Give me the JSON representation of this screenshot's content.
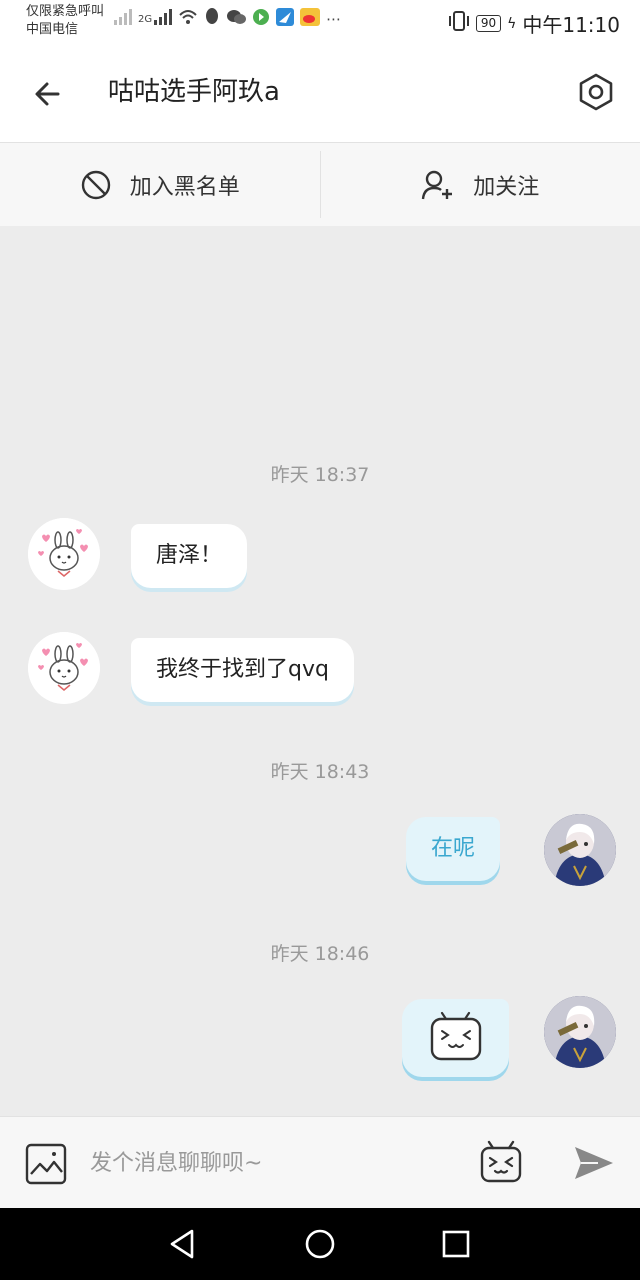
{
  "status_bar": {
    "carrier_line1": "仅限紧急呼叫",
    "carrier_line2": "中国电信",
    "network": "2G",
    "battery": "90",
    "time": "中午11:10"
  },
  "header": {
    "title": "咕咕选手阿玖a",
    "back_icon": "arrow-left-icon",
    "settings_icon": "hexagon-settings-icon"
  },
  "actions": {
    "blacklist_label": "加入黑名单",
    "follow_label": "加关注"
  },
  "chat": {
    "timestamps": [
      "昨天 18:37",
      "昨天 18:43",
      "昨天 18:46"
    ],
    "messages": [
      {
        "side": "in",
        "text": "唐泽！"
      },
      {
        "side": "in",
        "text": "我终于找到了qvq"
      },
      {
        "side": "out",
        "text": "在呢"
      },
      {
        "side": "out",
        "text": "",
        "sticker": "bilibili-tv-face-icon"
      }
    ]
  },
  "input": {
    "placeholder": "发个消息聊聊呗~"
  },
  "colors": {
    "accent": "#3aa7cf",
    "bubble_out_bg": "#e3f4fa",
    "chat_bg": "#ececec"
  }
}
